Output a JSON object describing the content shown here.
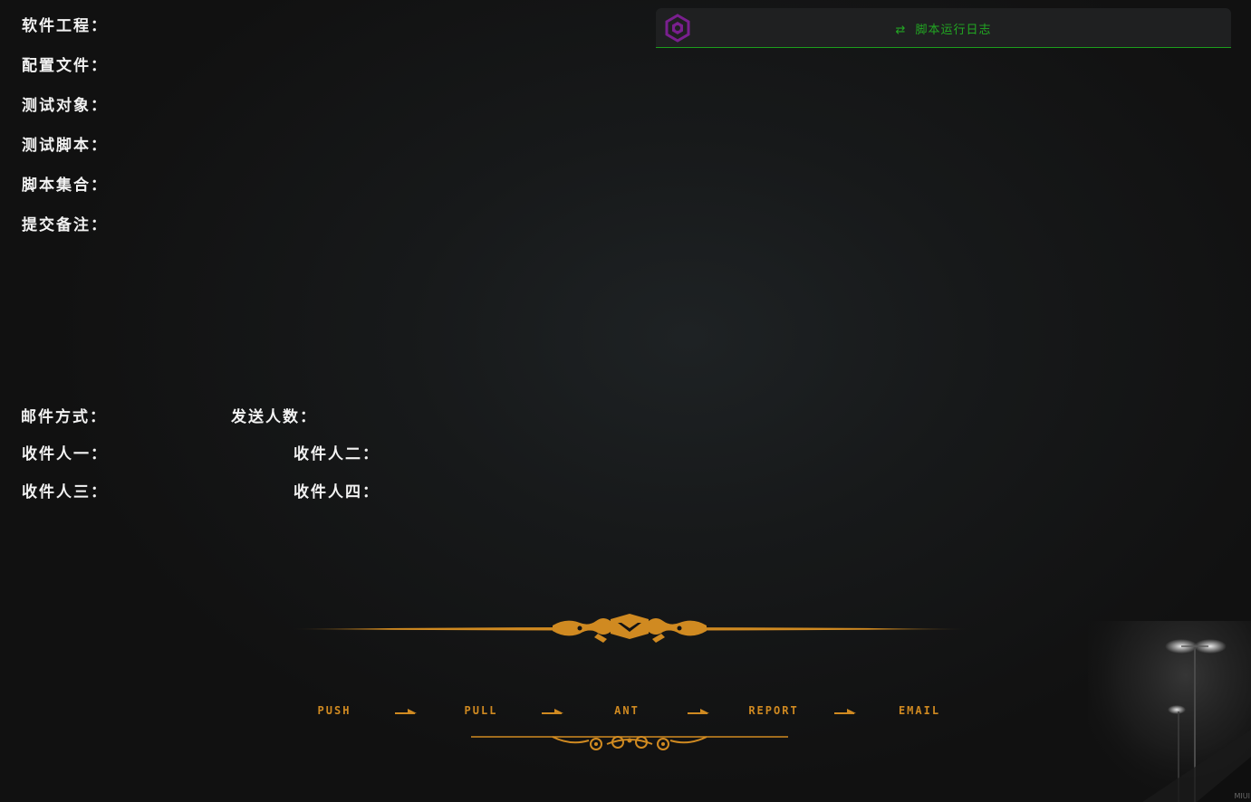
{
  "form": {
    "software_project_label": "软件工程：",
    "config_file_label": "配置文件：",
    "test_target_label": "测试对象：",
    "test_script_label": "测试脚本：",
    "script_collection_label": "脚本集合：",
    "commit_note_label": "提交备注：",
    "mail_method_label": "邮件方式：",
    "recipient_count_label": "发送人数：",
    "recipient1_label": "收件人一：",
    "recipient2_label": "收件人二：",
    "recipient3_label": "收件人三：",
    "recipient4_label": "收件人四："
  },
  "log_panel": {
    "title": "脚本运行日志",
    "logo_icon": "hexagon-logo-icon",
    "sync_icon": "sync-arrows-icon",
    "accent_color": "#22a822",
    "logo_color": "#7a1f8f"
  },
  "pipeline": {
    "steps": [
      "PUSH",
      "PULL",
      "ANT",
      "REPORT",
      "EMAIL"
    ],
    "color": "#d08a21"
  },
  "brand": "MIUI"
}
